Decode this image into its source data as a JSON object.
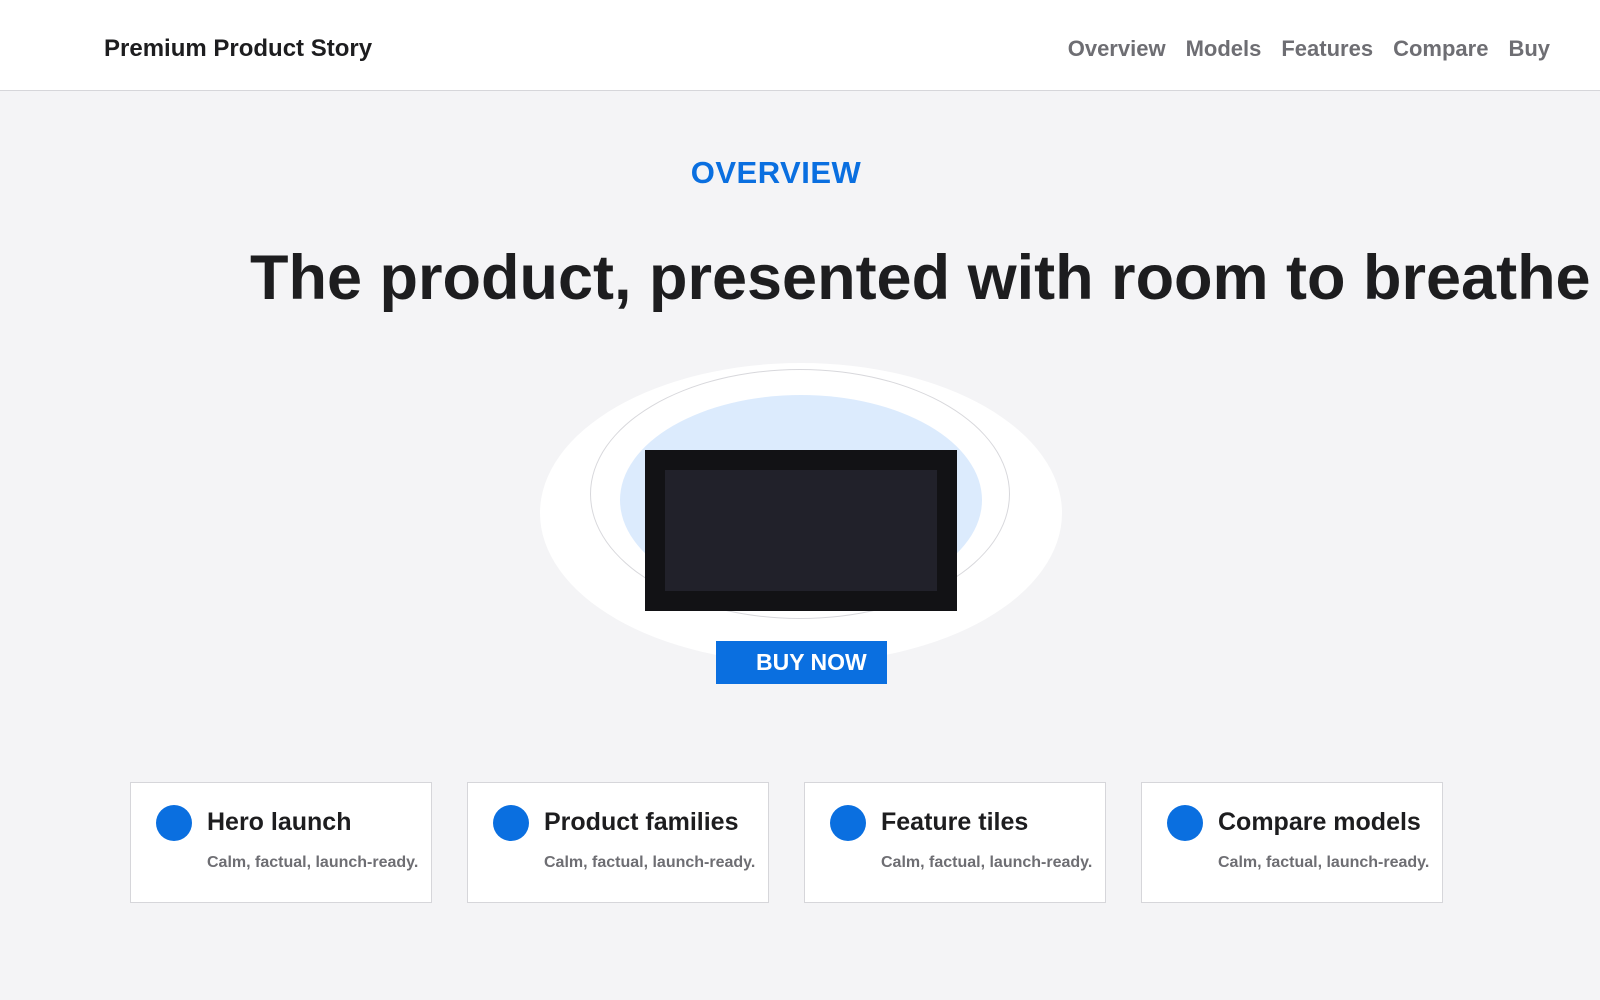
{
  "header": {
    "brand": "Premium Product Story",
    "nav": [
      "Overview",
      "Models",
      "Features",
      "Compare",
      "Buy"
    ]
  },
  "hero": {
    "eyebrow": "OVERVIEW",
    "headline": "The product, presented with room to breathe",
    "cta_label": "BUY NOW"
  },
  "cards": [
    {
      "title": "Hero launch",
      "subtitle": "Calm, factual, launch-ready."
    },
    {
      "title": "Product families",
      "subtitle": "Calm, factual, launch-ready."
    },
    {
      "title": "Feature tiles",
      "subtitle": "Calm, factual, launch-ready."
    },
    {
      "title": "Compare models",
      "subtitle": "Calm, factual, launch-ready."
    }
  ],
  "colors": {
    "accent": "#0a6fe0",
    "background": "#f4f4f6",
    "text": "#1d1d1f",
    "muted": "#6e6e73"
  }
}
